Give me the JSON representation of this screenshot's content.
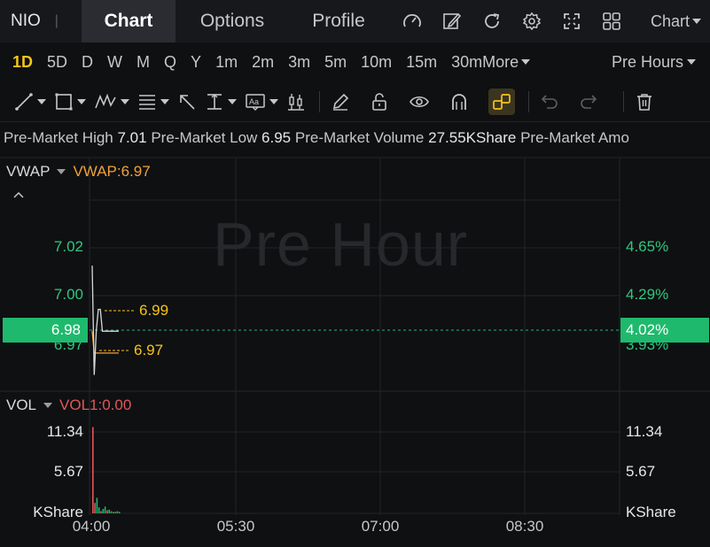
{
  "header": {
    "ticker": "NIO",
    "separator": "|",
    "tabs": [
      {
        "label": "Chart",
        "active": true
      },
      {
        "label": "Options",
        "active": false
      },
      {
        "label": "Profile",
        "active": false
      }
    ],
    "icons": [
      "gauge-icon",
      "edit-icon",
      "refresh-icon",
      "gear-icon",
      "fullscreen-icon",
      "grid-icon"
    ],
    "chart_menu": "Chart"
  },
  "timeframes": {
    "items": [
      "1D",
      "5D",
      "D",
      "W",
      "M",
      "Q",
      "Y",
      "1m",
      "2m",
      "3m",
      "5m",
      "10m",
      "15m",
      "30m"
    ],
    "active": "1D",
    "more": "More",
    "session": "Pre Hours"
  },
  "toolbar": {
    "tools": [
      "line-tool-icon",
      "rectangle-tool-icon",
      "pattern-tool-icon",
      "fib-tool-icon",
      "arrow-tool-icon",
      "measure-tool-icon",
      "text-tool-icon",
      "candle-tool-icon"
    ],
    "actions": [
      "pencil-icon",
      "unlock-icon",
      "eye-icon",
      "magnet-icon",
      "link-icon",
      "undo-icon",
      "redo-icon",
      "trash-icon"
    ]
  },
  "info": {
    "high_label": "Pre-Market High",
    "high_value": "7.01",
    "low_label": "Pre-Market Low",
    "low_value": "6.95",
    "volume_label": "Pre-Market Volume",
    "volume_value": "27.55KShare",
    "amount_label": "Pre-Market Amo"
  },
  "price_panel": {
    "indicator": "VWAP",
    "indicator_value": "VWAP:6.97",
    "watermark": "Pre Hour",
    "left_ticks": [
      "7.02",
      "7.00",
      "6.97"
    ],
    "right_ticks": [
      "4.65%",
      "4.29%",
      "3.93%"
    ],
    "current_price": "6.98",
    "current_pct": "4.02%",
    "high_annotation": "6.99",
    "low_annotation": "6.97"
  },
  "volume_panel": {
    "indicator": "VOL",
    "indicator_value": "VOL1:0.00",
    "ticks": [
      "11.34",
      "5.67",
      "KShare"
    ]
  },
  "x_axis": [
    "04:00",
    "05:30",
    "07:00",
    "08:30"
  ],
  "colors": {
    "up": "#1fb96d",
    "accent": "#f5c518",
    "vwap": "#f0a23a",
    "down": "#e0575a"
  },
  "chart_data": {
    "type": "line",
    "x": [
      "04:00",
      "04:01",
      "04:02",
      "04:03",
      "04:04",
      "04:05",
      "04:06",
      "04:07",
      "04:08",
      "04:09",
      "04:10",
      "04:12",
      "04:15",
      "04:20"
    ],
    "price": [
      7.01,
      6.96,
      6.98,
      6.99,
      6.99,
      6.98,
      6.98,
      6.98,
      6.98,
      6.98,
      6.98,
      6.98,
      6.98,
      6.98
    ],
    "vwap": [
      6.98,
      6.97,
      6.97,
      6.97,
      6.97,
      6.97,
      6.97,
      6.97,
      6.97,
      6.97,
      6.97,
      6.97,
      6.97,
      6.97
    ],
    "volume": [
      11.6,
      1.4,
      2.1,
      0.8,
      0.3,
      0.6,
      0.9,
      0.4,
      0.5,
      0.3,
      0.2,
      0.2,
      0.3,
      0.2
    ],
    "volume_up": [
      true,
      false,
      true,
      true,
      false,
      true,
      true,
      false,
      true,
      true,
      true,
      false,
      true,
      true
    ],
    "ylim_price": [
      6.955,
      7.04
    ],
    "ylim_volume": [
      0,
      12.5
    ]
  }
}
